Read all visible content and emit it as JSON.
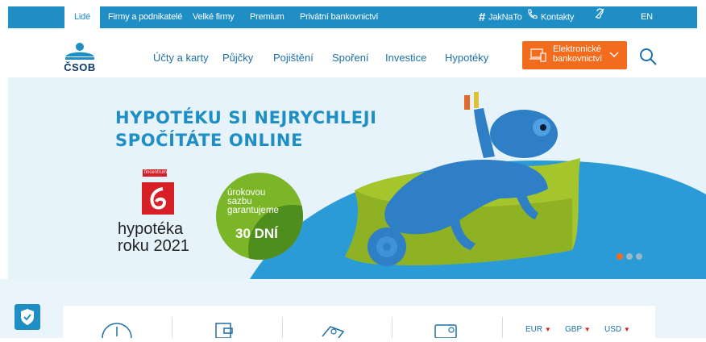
{
  "topbar": {
    "segments": [
      "Lidé",
      "Firmy a podnikatelé",
      "Velké firmy",
      "Premium",
      "Privátní bankovnictví"
    ],
    "active_segment": "Lidé",
    "jaknato": "JakNaTo",
    "contacts": "Kontakty",
    "lang": "EN"
  },
  "logo": {
    "text": "ČSOB"
  },
  "nav": {
    "items": [
      "Účty a karty",
      "Půjčky",
      "Pojištění",
      "Spoření",
      "Investice",
      "Hypotéky"
    ],
    "eb_button": "Elektronické bankovnictví"
  },
  "hero": {
    "title_line1": "HYPOTÉKU SI NEJRYCHLEJI",
    "title_line2": "SPOČÍTÁTE ONLINE",
    "award_tag": "fincentrum",
    "award_line1": "hypotéka",
    "award_line2": "roku 2021",
    "badge_small": "úrokovou sazbu garantujeme",
    "badge_big": "30 DNÍ",
    "slides": 3,
    "active_slide": 1
  },
  "currencies": [
    "EUR",
    "GBP",
    "USD"
  ],
  "colors": {
    "brand_blue": "#1e8ec5",
    "accent_orange": "#f36b1c",
    "hero_bg": "#e7f3fa"
  }
}
